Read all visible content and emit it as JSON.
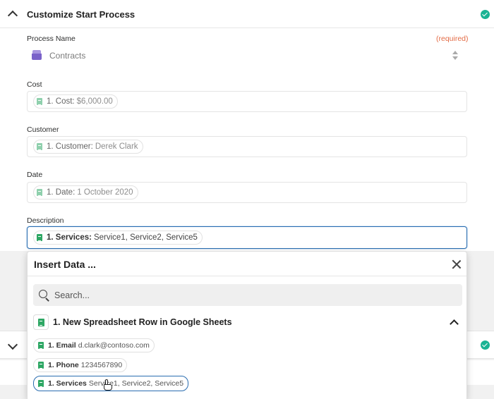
{
  "section": {
    "title": "Customize Start Process",
    "collapse_icon": "chevron-up-icon",
    "status_icon": "check-circle-icon",
    "status_color": "#1ab394"
  },
  "fields": {
    "process_name": {
      "label": "Process Name",
      "required_label": "(required)",
      "value": "Contracts",
      "icon": "inbox-tray-icon"
    },
    "cost": {
      "label": "Cost",
      "pill_key": "1. Cost:",
      "pill_value": "$6,000.00"
    },
    "customer": {
      "label": "Customer",
      "pill_key": "1. Customer:",
      "pill_value": "Derek Clark"
    },
    "date": {
      "label": "Date",
      "pill_key": "1. Date:",
      "pill_value": "1 October 2020"
    },
    "description": {
      "label": "Description",
      "pill_key": "1. Services:",
      "pill_value": "Service1, Service2, Service5"
    }
  },
  "insert_data": {
    "title": "Insert Data ...",
    "search_placeholder": "Search...",
    "group": {
      "title": "1. New Spreadsheet Row in Google Sheets",
      "icon": "google-sheets-icon",
      "options": [
        {
          "key": "1. Email",
          "value": "d.clark@contoso.com"
        },
        {
          "key": "1. Phone",
          "value": "1234567890"
        },
        {
          "key": "1. Services",
          "value": "Service1, Service2, Service5"
        }
      ]
    }
  },
  "colors": {
    "accent": "#2a6db0",
    "required": "#e36b45",
    "sheets_green": "#2ea764",
    "process_purple": "#7a62c9"
  }
}
